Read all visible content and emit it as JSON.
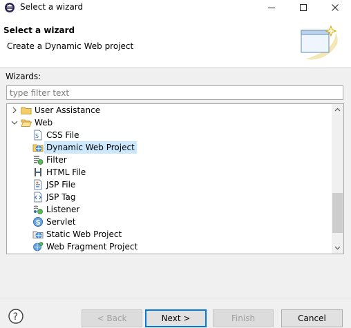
{
  "window": {
    "title": "Select a wizard",
    "minimize_glyph": "—",
    "maximize_glyph": "☐",
    "close_glyph": "✕"
  },
  "header": {
    "title": "Select a wizard",
    "description": "Create a Dynamic Web project"
  },
  "wizards": {
    "label": "Wizards:",
    "filter_placeholder": "type filter text",
    "filter_value": "",
    "items": [
      {
        "label": "User Assistance",
        "icon": "folder-icon",
        "expanded": false,
        "level": 0
      },
      {
        "label": "Web",
        "icon": "folder-open-icon",
        "expanded": true,
        "level": 0
      },
      {
        "label": "CSS File",
        "icon": "css-file-icon",
        "level": 1
      },
      {
        "label": "Dynamic Web Project",
        "icon": "dynamic-web-project-icon",
        "level": 1,
        "selected": true
      },
      {
        "label": "Filter",
        "icon": "filter-icon",
        "level": 1
      },
      {
        "label": "HTML File",
        "icon": "html-file-icon",
        "level": 1
      },
      {
        "label": "JSP File",
        "icon": "jsp-file-icon",
        "level": 1
      },
      {
        "label": "JSP Tag",
        "icon": "jsp-tag-icon",
        "level": 1
      },
      {
        "label": "Listener",
        "icon": "listener-icon",
        "level": 1
      },
      {
        "label": "Servlet",
        "icon": "servlet-icon",
        "level": 1
      },
      {
        "label": "Static Web Project",
        "icon": "static-web-project-icon",
        "level": 1
      },
      {
        "label": "Web Fragment Project",
        "icon": "web-fragment-project-icon",
        "level": 1
      }
    ]
  },
  "buttons": {
    "help_icon": "help-icon",
    "back": "< Back",
    "next": "Next >",
    "finish": "Finish",
    "cancel": "Cancel"
  },
  "colors": {
    "selection": "#cce8ff",
    "default_button_border": "#0078d7",
    "folder": "#e8b84a"
  }
}
